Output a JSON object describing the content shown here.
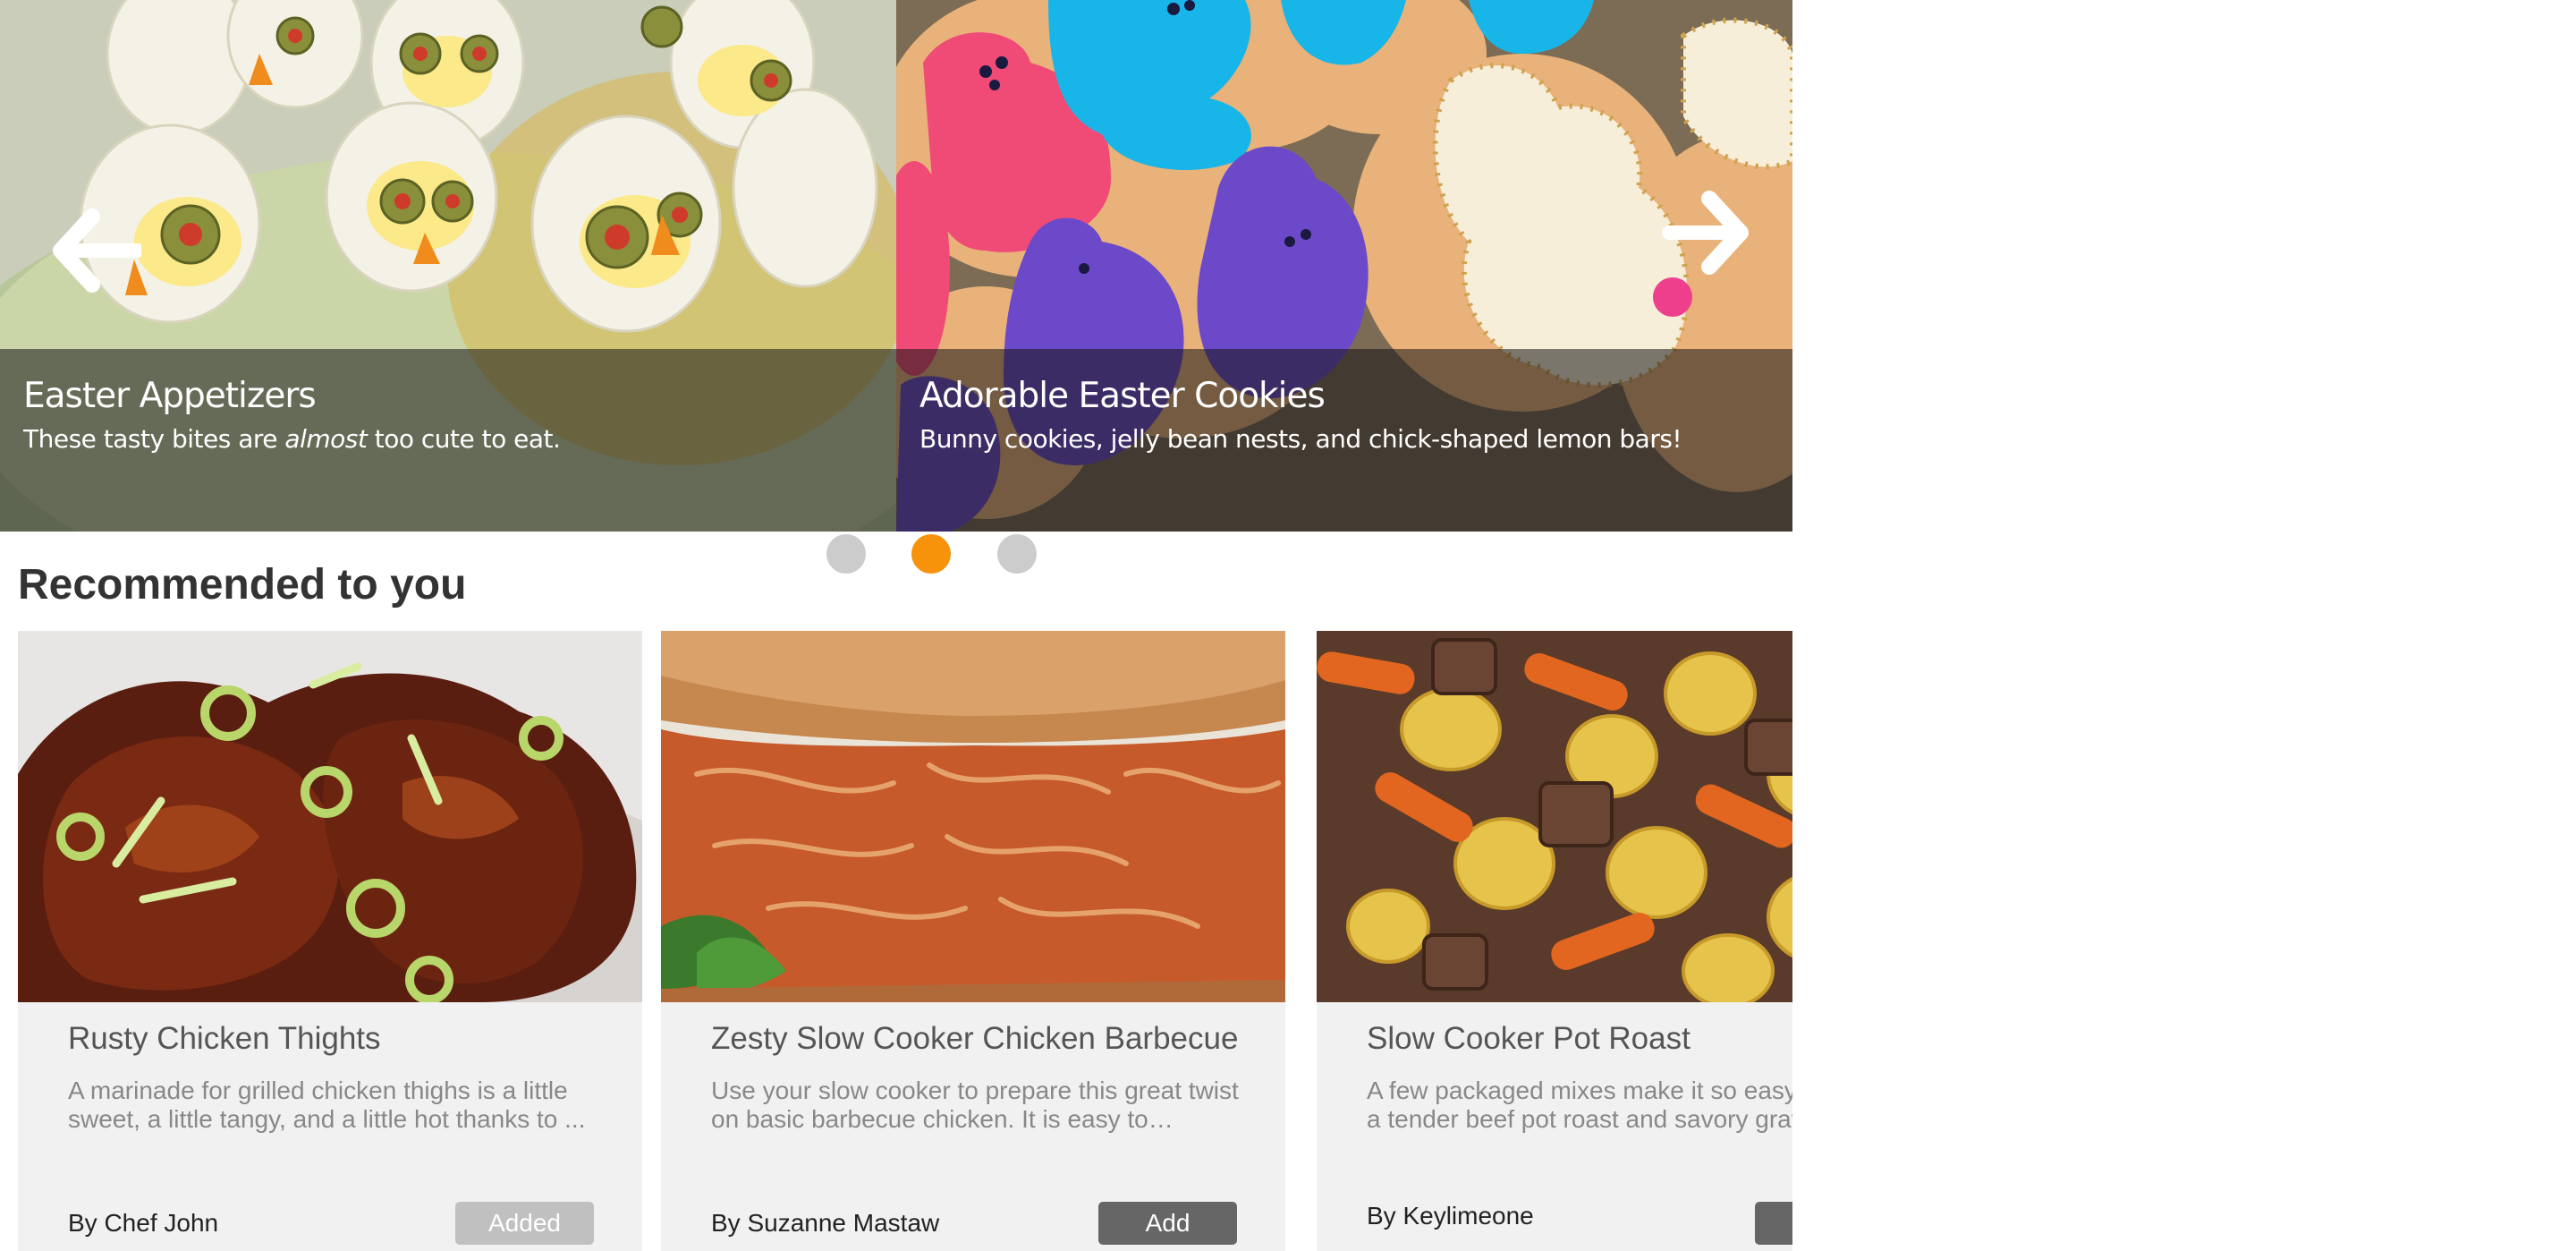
{
  "carousel": {
    "slides": [
      {
        "title": "Easter Appetizers",
        "subtitle_before": "These tasty bites are ",
        "subtitle_emphasis": "almost",
        "subtitle_after": " too cute to eat."
      },
      {
        "title": "Adorable Easter Cookies",
        "subtitle": "Bunny cookies, jelly bean nests, and chick-shaped lemon bars!"
      }
    ],
    "prev_icon": "arrow-left-icon",
    "next_icon": "arrow-right-icon",
    "dots": {
      "count": 3,
      "active_index": 1,
      "active_color": "#f7920b",
      "inactive_color": "#cccccc"
    }
  },
  "recommended": {
    "heading": "Recommended to you",
    "cards": [
      {
        "title": "Rusty Chicken Thights",
        "description": "A marinade for grilled chicken thighs is a little sweet, a little tangy, and a little hot thanks to ...",
        "author": "By Chef John",
        "button": "Added"
      },
      {
        "title": "Zesty Slow Cooker Chicken Barbecue",
        "description": "Use your slow cooker to prepare this great twist on basic barbecue chicken. It is easy to…",
        "author": "By Suzanne Mastaw",
        "button": "Add"
      },
      {
        "title": "Slow Cooker Pot Roast",
        "description": "A few packaged mixes make it so easy to make a tender beef pot roast and savory gravy.",
        "author": "By Keylimeone",
        "button": ""
      }
    ]
  }
}
